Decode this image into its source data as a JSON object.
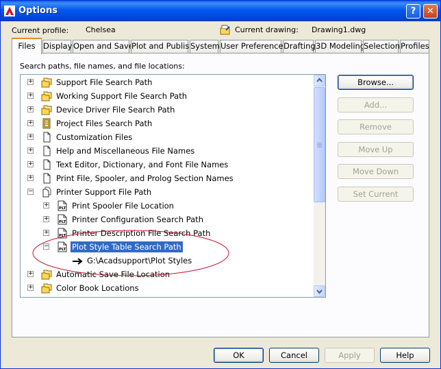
{
  "window": {
    "title": "Options"
  },
  "titlebar": {
    "help_glyph": "?",
    "close_glyph": "✕"
  },
  "profile": {
    "current_profile_label": "Current profile:",
    "current_profile_value": "Chelsea",
    "current_drawing_label": "Current drawing:",
    "current_drawing_value": "Drawing1.dwg"
  },
  "tabs": [
    {
      "label": "Files",
      "active": true
    },
    {
      "label": "Display"
    },
    {
      "label": "Open and Save"
    },
    {
      "label": "Plot and Publish"
    },
    {
      "label": "System"
    },
    {
      "label": "User Preferences"
    },
    {
      "label": "Drafting"
    },
    {
      "label": "3D Modeling"
    },
    {
      "label": "Selection"
    },
    {
      "label": "Profiles"
    }
  ],
  "files": {
    "section_label": "Search paths, file names, and file locations:",
    "tree": [
      {
        "label": "Support File Search Path",
        "icon": "folder-stack-icon",
        "expander": "+"
      },
      {
        "label": "Working Support File Search Path",
        "icon": "folder-stack-icon",
        "expander": "+"
      },
      {
        "label": "Device Driver File Search Path",
        "icon": "folder-stack-icon",
        "expander": "+"
      },
      {
        "label": "Project Files Search Path",
        "icon": "project-file-icon",
        "expander": "+"
      },
      {
        "label": "Customization Files",
        "icon": "document-icon",
        "expander": "+"
      },
      {
        "label": "Help and Miscellaneous File Names",
        "icon": "document-icon",
        "expander": "+"
      },
      {
        "label": "Text Editor, Dictionary, and Font File Names",
        "icon": "document-icon",
        "expander": "+"
      },
      {
        "label": "Print File, Spooler, and Prolog Section Names",
        "icon": "document-icon",
        "expander": "+"
      },
      {
        "label": "Printer Support File Path",
        "icon": "documents-icon",
        "expander": "−"
      },
      {
        "label": "Print Spooler File Location",
        "icon": "plt-file-icon",
        "expander": "+"
      },
      {
        "label": "Printer Configuration Search Path",
        "icon": "plt-file-icon",
        "expander": "+"
      },
      {
        "label": "Printer Description File Search Path",
        "icon": "plt-file-icon",
        "expander": "+"
      },
      {
        "label": "Plot Style Table Search Path",
        "icon": "plt-file-icon",
        "expander": "−",
        "selected": true
      },
      {
        "label": "G:\\Acadsupport\\Plot Styles",
        "icon": "path-arrow-icon"
      },
      {
        "label": "Automatic Save File Location",
        "icon": "folder-stack-icon",
        "expander": "+"
      },
      {
        "label": "Color Book Locations",
        "icon": "folder-stack-icon",
        "expander": "+"
      }
    ],
    "buttons": {
      "browse": "Browse...",
      "add": "Add...",
      "remove": "Remove",
      "move_up": "Move Up",
      "move_down": "Move Down",
      "set_current": "Set Current"
    }
  },
  "dialog_buttons": {
    "ok": "OK",
    "cancel": "Cancel",
    "apply": "Apply",
    "help": "Help"
  },
  "colors": {
    "selection": "#316ac5",
    "annotation_circle": "#c8102e",
    "titlebar": "#0058ee",
    "folder": "#ffd75a"
  }
}
